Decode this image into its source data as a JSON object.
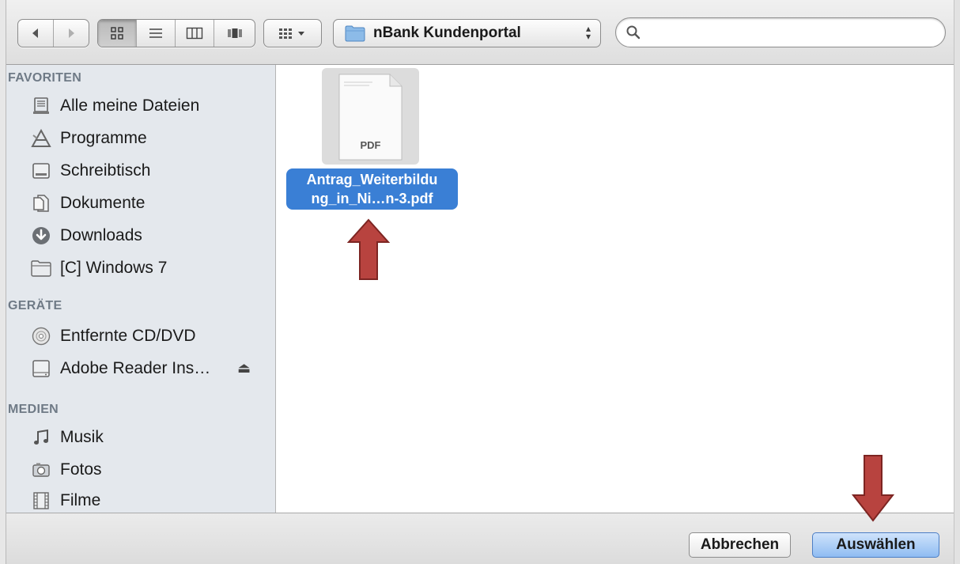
{
  "toolbar": {
    "nav": {
      "back_icon": "back-arrow-icon",
      "forward_icon": "forward-arrow-icon"
    },
    "views": [
      "icon-view",
      "list-view",
      "column-view",
      "coverflow-view"
    ],
    "arrange_icon": "arrange-icon",
    "location": "nBank Kundenportal",
    "search": {
      "value": "",
      "placeholder": ""
    }
  },
  "sidebar": {
    "favorites_header": "FAVORITEN",
    "favorites": [
      {
        "label": "Alle meine Dateien",
        "icon": "all-files-icon"
      },
      {
        "label": "Programme",
        "icon": "applications-icon"
      },
      {
        "label": "Schreibtisch",
        "icon": "desktop-icon"
      },
      {
        "label": "Dokumente",
        "icon": "documents-icon"
      },
      {
        "label": "Downloads",
        "icon": "downloads-icon"
      },
      {
        "label": "[C] Windows 7",
        "icon": "folder-icon"
      }
    ],
    "devices_header": "GERÄTE",
    "devices": [
      {
        "label": "Entfernte CD/DVD",
        "icon": "disc-icon"
      },
      {
        "label": "Adobe Reader Ins…",
        "icon": "drive-icon",
        "eject": "⏏"
      }
    ],
    "media_header": "MEDIEN",
    "media": [
      {
        "label": "Musik",
        "icon": "music-icon"
      },
      {
        "label": "Fotos",
        "icon": "camera-icon"
      },
      {
        "label": "Filme",
        "icon": "film-icon"
      }
    ]
  },
  "files": [
    {
      "thumb_text": "PDF",
      "name_line1": "Antrag_Weiterbildu",
      "name_line2": "ng_in_Ni…n-3.pdf",
      "selected": true
    }
  ],
  "footer": {
    "cancel_label": "Abbrechen",
    "confirm_label": "Auswählen"
  },
  "colors": {
    "selection": "#3a7fd5",
    "annotation_arrow": "#b8433f",
    "sidebar_bg": "#e4e8ed"
  }
}
